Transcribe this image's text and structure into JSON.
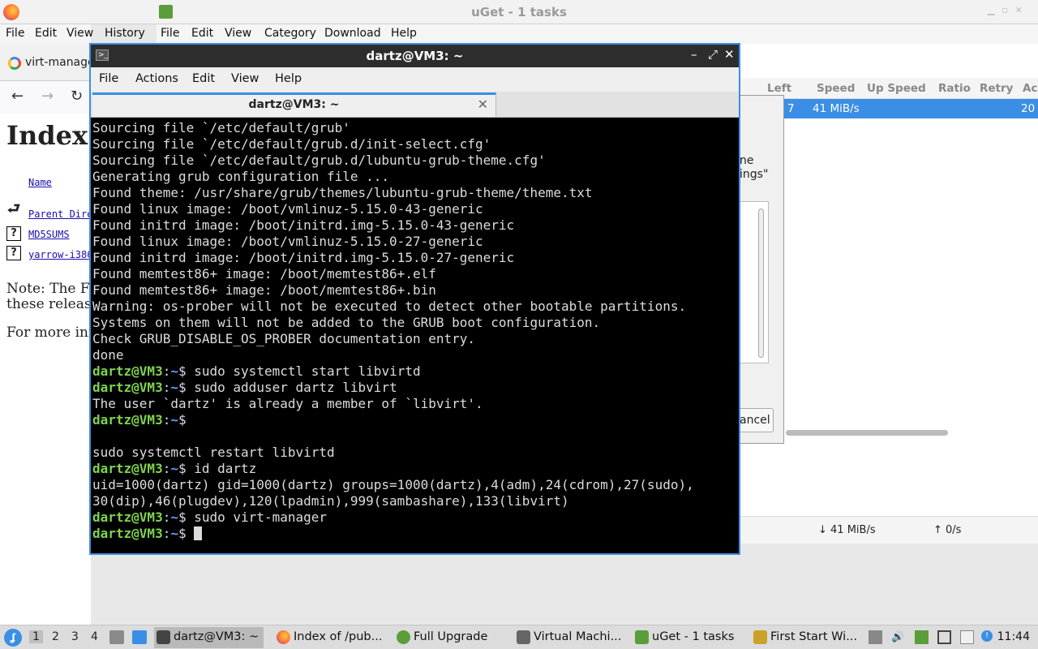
{
  "uget": {
    "title": "uGet - 1 tasks",
    "menu": [
      "File",
      "Edit",
      "View",
      "Category",
      "Download",
      "Help"
    ],
    "columns": [
      "Left",
      "Speed",
      "Up Speed",
      "Ratio",
      "Retry",
      "Ac"
    ],
    "row": {
      "left": "7",
      "speed": "41 MiB/s",
      "added": "20"
    },
    "status": {
      "down": "↓ 41 MiB/s",
      "up": "↑ 0/s"
    },
    "dialog": {
      "text1": "ne",
      "text2": "ings\"",
      "cancel": "ancel"
    }
  },
  "firefox": {
    "menu": [
      "File",
      "Edit",
      "View",
      "History"
    ],
    "tab_label": "virt-manage",
    "heading": "Index",
    "name_col": "Name",
    "links": [
      "Parent Dire",
      "MD5SUMS",
      "yarrow-i386"
    ],
    "note_line1": "Note: The Fe",
    "note_line2": "these release",
    "more_info": "For more inf"
  },
  "terminal": {
    "title": "dartz@VM3: ~",
    "tab_title": "dartz@VM3: ~",
    "menu": [
      "File",
      "Actions",
      "Edit",
      "View",
      "Help"
    ],
    "user_host": "dartz@VM3",
    "path": "~",
    "output": [
      "Sourcing file `/etc/default/grub'",
      "Sourcing file `/etc/default/grub.d/init-select.cfg'",
      "Sourcing file `/etc/default/grub.d/lubuntu-grub-theme.cfg'",
      "Generating grub configuration file ...",
      "Found theme: /usr/share/grub/themes/lubuntu-grub-theme/theme.txt",
      "Found linux image: /boot/vmlinuz-5.15.0-43-generic",
      "Found initrd image: /boot/initrd.img-5.15.0-43-generic",
      "Found linux image: /boot/vmlinuz-5.15.0-27-generic",
      "Found initrd image: /boot/initrd.img-5.15.0-27-generic",
      "Found memtest86+ image: /boot/memtest86+.elf",
      "Found memtest86+ image: /boot/memtest86+.bin",
      "Warning: os-prober will not be executed to detect other bootable partitions.",
      "Systems on them will not be added to the GRUB boot configuration.",
      "Check GRUB_DISABLE_OS_PROBER documentation entry.",
      "done"
    ],
    "cmd1": "$ sudo systemctl start libvirtd",
    "cmd2": "$ sudo adduser dartz libvirt",
    "out2": "The user `dartz' is already a member of `libvirt'.",
    "cmd3": "$",
    "blank": "",
    "restart": "sudo systemctl restart libvirtd",
    "cmd4": "$ id dartz",
    "out4a": "uid=1000(dartz) gid=1000(dartz) groups=1000(dartz),4(adm),24(cdrom),27(sudo),",
    "out4b": "30(dip),46(plugdev),120(lpadmin),999(sambashare),133(libvirt)",
    "cmd5": "$ sudo virt-manager",
    "cmd6": "$ "
  },
  "taskbar": {
    "workspaces": [
      "1",
      "2",
      "3",
      "4"
    ],
    "tasks": [
      "dartz@VM3: ~",
      "Index of /pub...",
      "Full Upgrade",
      "Virtual Machi...",
      "uGet - 1 tasks",
      "First Start Wi..."
    ],
    "clock": "11:44"
  }
}
